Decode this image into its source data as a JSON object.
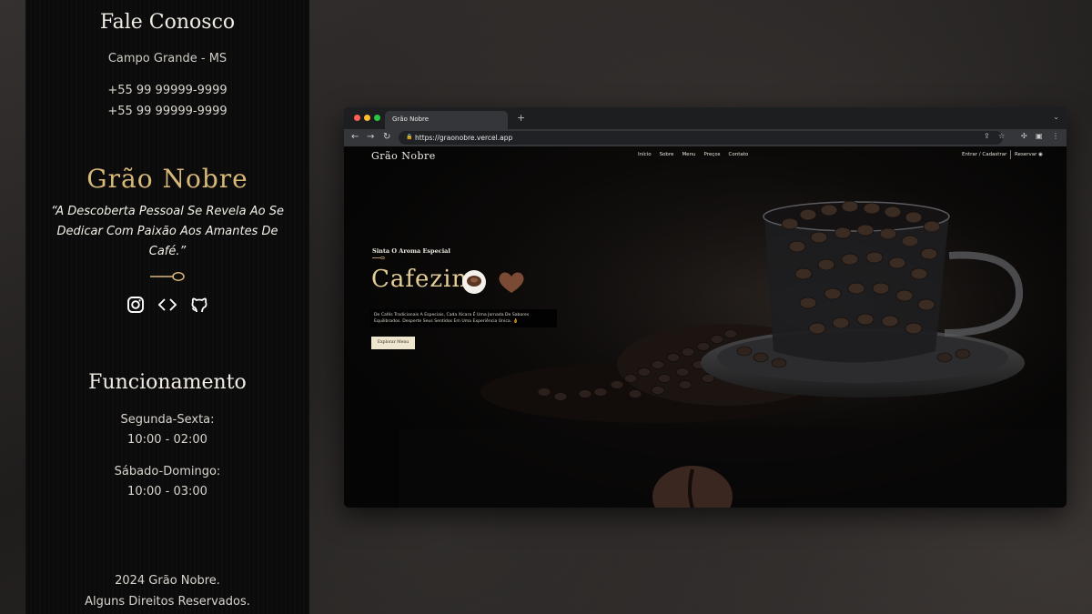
{
  "contact": {
    "title": "Fale Conosco",
    "city": "Campo Grande - MS",
    "phone_1": "+55 99 99999-9999",
    "phone_2": "+55 99 99999-9999"
  },
  "brand": {
    "name": "Grão Nobre",
    "quote": "“A Descoberta Pessoal Se Revela Ao Se Dedicar Com Paixão Aos Amantes De Café.”"
  },
  "socials": [
    {
      "icon": "instagram-icon"
    },
    {
      "icon": "code-icon"
    },
    {
      "icon": "github-icon"
    }
  ],
  "hours": {
    "title": "Funcionamento",
    "weekday_label": "Segunda-Sexta:",
    "weekday_time": "10:00 - 02:00",
    "weekend_label": "Sábado-Domingo:",
    "weekend_time": "10:00 - 03:00"
  },
  "footer": {
    "line_1": "2024 Grão Nobre.",
    "line_2": "Alguns Direitos Reservados."
  },
  "browser": {
    "tab_title": "Grão Nobre",
    "url": "https://graonobre.vercel.app"
  },
  "site": {
    "logo": "Grão Nobre",
    "nav": [
      "Início",
      "Sobre",
      "Menu",
      "Preços",
      "Contato"
    ],
    "login": "Entrar / Cadastrar",
    "reserve": "Reservar",
    "hero_subtitle": "Sinta O Aroma Especial",
    "hero_title": "Cafezin",
    "hero_description": "De Cafés Tradicionais A Especiais, Cada Xícara É Uma Jornada De Sabores Equilibrados. Desperte Seus Sentidos Em Uma Experiência Única. 👌",
    "hero_button": "Explorar Menu"
  },
  "colors": {
    "gold": "#d9b978",
    "panel": "#0b0b0b",
    "button": "#efe6cf"
  }
}
